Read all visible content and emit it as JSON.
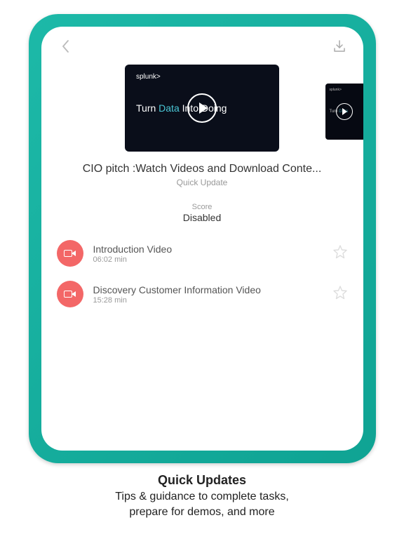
{
  "hero": {
    "logo": "splunk>",
    "tagline_prefix": "Turn ",
    "tagline_highlight": "Data",
    "tagline_suffix": " Into Doing"
  },
  "page": {
    "title": "CIO pitch :Watch Videos and Download Conte...",
    "subtitle": "Quick Update",
    "score_label": "Score",
    "score_value": "Disabled"
  },
  "items": [
    {
      "title": "Introduction Video",
      "duration": "06:02 min"
    },
    {
      "title": "Discovery Customer Information Video",
      "duration": "15:28 min"
    }
  ],
  "caption": {
    "title": "Quick Updates",
    "line1": "Tips & guidance to complete tasks,",
    "line2": "prepare for demos, and more"
  }
}
